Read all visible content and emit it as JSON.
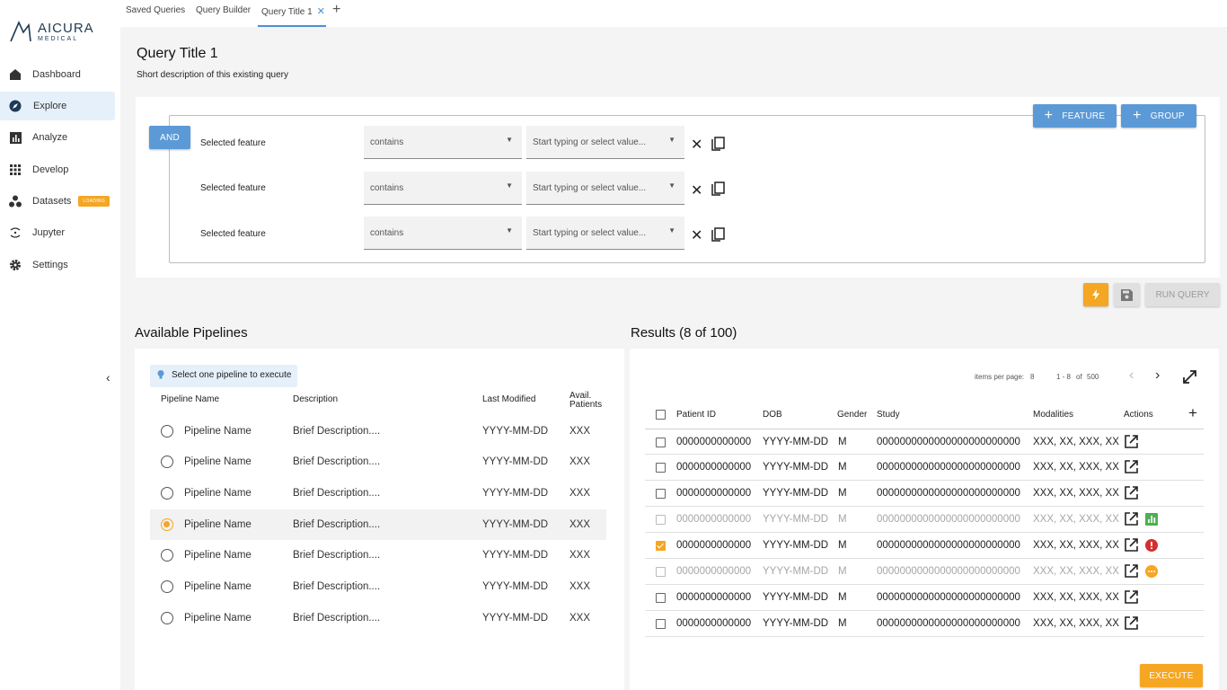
{
  "brand": {
    "name": "AICURA",
    "sub": "MEDICAL"
  },
  "nav": [
    {
      "label": "Dashboard",
      "icon": "home-icon"
    },
    {
      "label": "Explore",
      "icon": "compass-icon",
      "active": true
    },
    {
      "label": "Analyze",
      "icon": "bar-chart-icon"
    },
    {
      "label": "Develop",
      "icon": "grid-icon"
    },
    {
      "label": "Datasets",
      "icon": "scatter-icon",
      "badge": "LOADING"
    },
    {
      "label": "Jupyter",
      "icon": "jupyter-icon"
    },
    {
      "label": "Settings",
      "icon": "gear-icon"
    }
  ],
  "tabs": {
    "saved": "Saved Queries",
    "builder": "Query Builder",
    "active": "Query Title 1"
  },
  "query": {
    "title": "Query Title 1",
    "description": "Short description of this existing query",
    "logic": "AND",
    "feature_btn": "FEATURE",
    "group_btn": "GROUP",
    "rows": [
      {
        "feature": "Selected feature",
        "operator": "contains",
        "value_placeholder": "Start typing or select value..."
      },
      {
        "feature": "Selected feature",
        "operator": "contains",
        "value_placeholder": "Start typing or select value..."
      },
      {
        "feature": "Selected feature",
        "operator": "contains",
        "value_placeholder": "Start typing or select value..."
      }
    ],
    "run_btn": "RUN QUERY"
  },
  "pipelines": {
    "title": "Available Pipelines",
    "hint": "Select one pipeline to execute",
    "headers": {
      "name": "Pipeline Name",
      "description": "Description",
      "modified": "Last Modified",
      "avail1": "Avail.",
      "avail2": "Patients"
    },
    "rows": [
      {
        "name": "Pipeline Name",
        "description": "Brief Description....",
        "modified": "YYYY-MM-DD",
        "patients": "XXX",
        "selected": false
      },
      {
        "name": "Pipeline Name",
        "description": "Brief Description....",
        "modified": "YYYY-MM-DD",
        "patients": "XXX",
        "selected": false
      },
      {
        "name": "Pipeline Name",
        "description": "Brief Description....",
        "modified": "YYYY-MM-DD",
        "patients": "XXX",
        "selected": false
      },
      {
        "name": "Pipeline Name",
        "description": "Brief Description....",
        "modified": "YYYY-MM-DD",
        "patients": "XXX",
        "selected": true
      },
      {
        "name": "Pipeline Name",
        "description": "Brief Description....",
        "modified": "YYYY-MM-DD",
        "patients": "XXX",
        "selected": false
      },
      {
        "name": "Pipeline Name",
        "description": "Brief Description....",
        "modified": "YYYY-MM-DD",
        "patients": "XXX",
        "selected": false
      },
      {
        "name": "Pipeline Name",
        "description": "Brief Description....",
        "modified": "YYYY-MM-DD",
        "patients": "XXX",
        "selected": false
      }
    ]
  },
  "results": {
    "title": "Results (8 of 100)",
    "items_per_page_label": "items per page:",
    "items_per_page": "8",
    "range": "1 - 8",
    "of": "of",
    "total": "500",
    "headers": {
      "patient": "Patient ID",
      "dob": "DOB",
      "gender": "Gender",
      "study": "Study",
      "modalities": "Modalities",
      "actions": "Actions"
    },
    "rows": [
      {
        "id": "0000000000000",
        "dob": "YYYY-MM-DD",
        "gender": "M",
        "study": "0000000000000000000000000",
        "modalities": "XXX, XX, XXX, XX",
        "dim": false,
        "checked": false,
        "status": ""
      },
      {
        "id": "0000000000000",
        "dob": "YYYY-MM-DD",
        "gender": "M",
        "study": "0000000000000000000000000",
        "modalities": "XXX, XX, XXX, XX",
        "dim": false,
        "checked": false,
        "status": ""
      },
      {
        "id": "0000000000000",
        "dob": "YYYY-MM-DD",
        "gender": "M",
        "study": "0000000000000000000000000",
        "modalities": "XXX, XX, XXX, XX",
        "dim": false,
        "checked": false,
        "status": ""
      },
      {
        "id": "0000000000000",
        "dob": "YYYY-MM-DD",
        "gender": "M",
        "study": "0000000000000000000000000",
        "modalities": "XXX, XX, XXX, XX",
        "dim": true,
        "checked": false,
        "status": "chart"
      },
      {
        "id": "0000000000000",
        "dob": "YYYY-MM-DD",
        "gender": "M",
        "study": "0000000000000000000000000",
        "modalities": "XXX, XX, XXX, XX",
        "dim": false,
        "checked": true,
        "status": "error"
      },
      {
        "id": "0000000000000",
        "dob": "YYYY-MM-DD",
        "gender": "M",
        "study": "0000000000000000000000000",
        "modalities": "XXX, XX, XXX, XX",
        "dim": true,
        "checked": false,
        "status": "pending"
      },
      {
        "id": "0000000000000",
        "dob": "YYYY-MM-DD",
        "gender": "M",
        "study": "0000000000000000000000000",
        "modalities": "XXX, XX, XXX, XX",
        "dim": false,
        "checked": false,
        "status": ""
      },
      {
        "id": "0000000000000",
        "dob": "YYYY-MM-DD",
        "gender": "M",
        "study": "0000000000000000000000000",
        "modalities": "XXX, XX, XXX, XX",
        "dim": false,
        "checked": false,
        "status": ""
      }
    ],
    "execute_btn": "EXECUTE"
  },
  "colors": {
    "primary": "#5b9ad6",
    "accent": "#f5a623",
    "success": "#4caf50",
    "error": "#d32f2f"
  }
}
